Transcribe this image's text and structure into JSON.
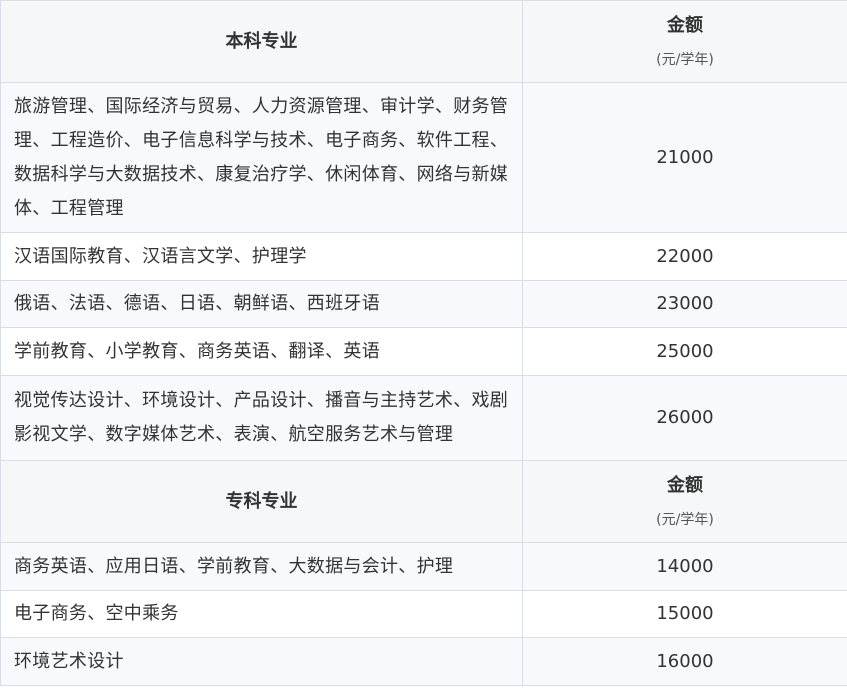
{
  "undergrad": {
    "header_label": "本科专业",
    "amount_label": "金额",
    "amount_unit": "(元/学年)",
    "rows": [
      {
        "majors": "旅游管理、国际经济与贸易、人力资源管理、审计学、财务管理、工程造价、电子信息科学与技术、电子商务、软件工程、数据科学与大数据技术、康复治疗学、休闲体育、网络与新媒体、工程管理",
        "amount": "21000"
      },
      {
        "majors": "汉语国际教育、汉语言文学、护理学",
        "amount": "22000"
      },
      {
        "majors": "俄语、法语、德语、日语、朝鲜语、西班牙语",
        "amount": "23000"
      },
      {
        "majors": "学前教育、小学教育、商务英语、翻译、英语",
        "amount": "25000"
      },
      {
        "majors": "视觉传达设计、环境设计、产品设计、播音与主持艺术、戏剧影视文学、数字媒体艺术、表演、航空服务艺术与管理",
        "amount": "26000"
      }
    ]
  },
  "college": {
    "header_label": "专科专业",
    "amount_label": "金额",
    "amount_unit": "(元/学年)",
    "rows": [
      {
        "majors": "商务英语、应用日语、学前教育、大数据与会计、护理",
        "amount": "14000"
      },
      {
        "majors": "电子商务、空中乘务",
        "amount": "15000"
      },
      {
        "majors": "环境艺术设计",
        "amount": "16000"
      }
    ]
  }
}
